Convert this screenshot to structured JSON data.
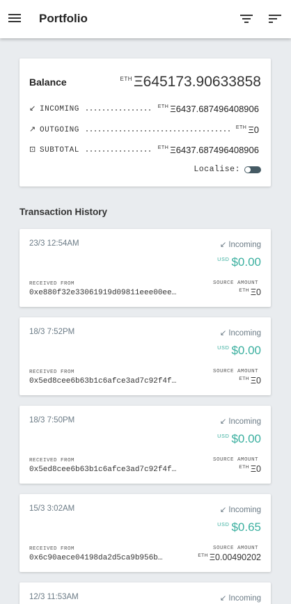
{
  "app": {
    "title": "Portfolio",
    "icons": {
      "menu": "hamburger-menu-icon",
      "filter": "filter-icon",
      "sort": "sort-icon"
    }
  },
  "balance": {
    "label": "Balance",
    "eth_symbol": "ETH",
    "value": "Ξ645173.90633858",
    "rows": [
      {
        "icon": "↙",
        "label": "INCOMING",
        "currency": "ETH",
        "value": "Ξ6437.687496408906"
      },
      {
        "icon": "↗",
        "label": "OUTGOING",
        "currency": "ETH",
        "value": "Ξ0"
      },
      {
        "icon": "⊡",
        "label": "SUBTOTAL",
        "currency": "ETH",
        "value": "Ξ6437.687496408906"
      }
    ],
    "localise_label": "Localise:",
    "localise_on": false
  },
  "history": {
    "title": "Transaction History",
    "received_from_label": "RECEIVED FROM",
    "source_amount_label": "SOURCE AMOUNT",
    "transactions": [
      {
        "date": "23/3 12:54AM",
        "direction": "Incoming",
        "usd_currency": "USD",
        "usd": "$0.00",
        "address": "0xe880f32e33061919d09811eee00ee…",
        "eth_currency": "ETH",
        "amount": "Ξ0"
      },
      {
        "date": "18/3 7:52PM",
        "direction": "Incoming",
        "usd_currency": "USD",
        "usd": "$0.00",
        "address": "0x5ed8cee6b63b1c6afce3ad7c92f4f…",
        "eth_currency": "ETH",
        "amount": "Ξ0"
      },
      {
        "date": "18/3 7:50PM",
        "direction": "Incoming",
        "usd_currency": "USD",
        "usd": "$0.00",
        "address": "0x5ed8cee6b63b1c6afce3ad7c92f4f…",
        "eth_currency": "ETH",
        "amount": "Ξ0"
      },
      {
        "date": "15/3 3:02AM",
        "direction": "Incoming",
        "usd_currency": "USD",
        "usd": "$0.65",
        "address": "0x6c90aece04198da2d5ca9b956b…",
        "eth_currency": "ETH",
        "amount": "Ξ0.00490202"
      },
      {
        "date": "12/3 11:53AM",
        "direction": "Incoming"
      }
    ]
  },
  "colors": {
    "accent": "#3aaf9f",
    "muted": "#6a7a85",
    "toggle": "#455a64",
    "background": "#e9ecef"
  }
}
